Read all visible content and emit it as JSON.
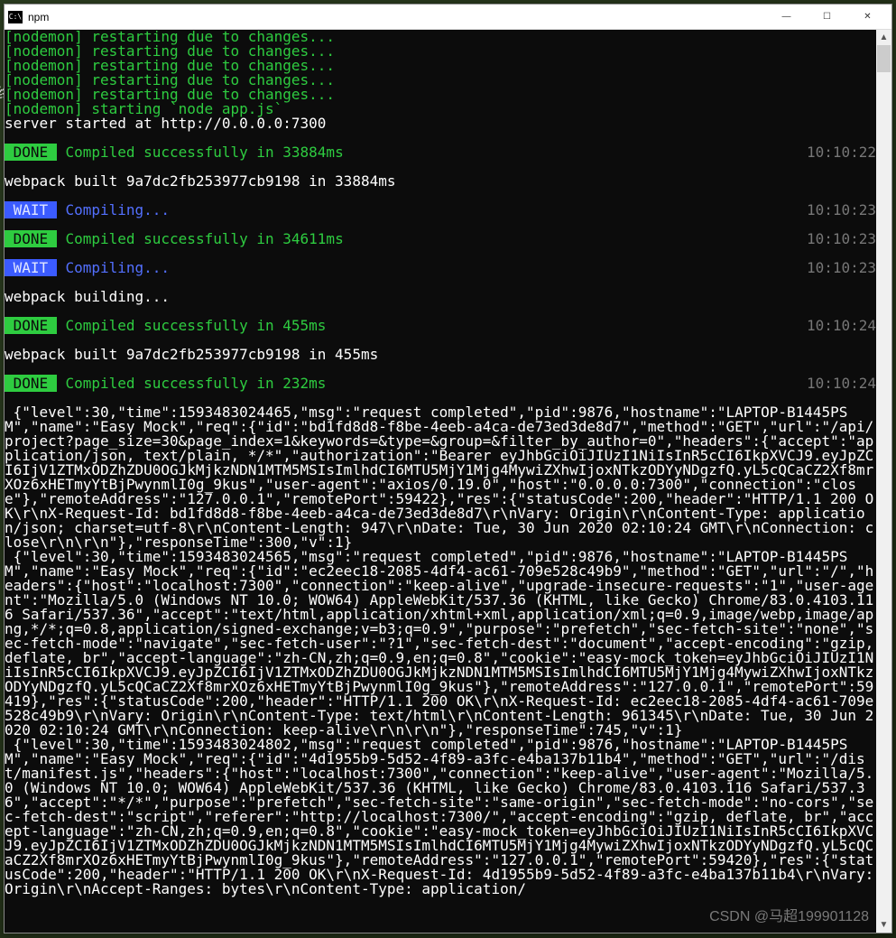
{
  "titlebar": {
    "title": "npm",
    "icon_label": "C:\\"
  },
  "controls": {
    "min": "—",
    "max": "☐",
    "close": "✕"
  },
  "nodemon_lines": [
    "[nodemon] restarting due to changes...",
    "[nodemon] restarting due to changes...",
    "[nodemon] restarting due to changes...",
    "[nodemon] restarting due to changes...",
    "[nodemon] restarting due to changes...",
    "[nodemon] starting `node app.js`"
  ],
  "server_line": "server started at http://0.0.0.0:7300",
  "events": [
    {
      "badge": "DONE",
      "badge_class": "badge-done",
      "msg": " Compiled successfully in 33884ms",
      "msg_class": "compiled",
      "time": "10:10:22",
      "after": "webpack built 9a7dc2fb253977cb9198 in 33884ms"
    },
    {
      "badge": "WAIT",
      "badge_class": "badge-wait",
      "msg": " Compiling...",
      "msg_class": "compiling",
      "time": "10:10:23",
      "after": ""
    },
    {
      "badge": "DONE",
      "badge_class": "badge-done",
      "msg": " Compiled successfully in 34611ms",
      "msg_class": "compiled",
      "time": "10:10:23",
      "after": ""
    },
    {
      "badge": "WAIT",
      "badge_class": "badge-wait",
      "msg": " Compiling...",
      "msg_class": "compiling",
      "time": "10:10:23",
      "after": "webpack building..."
    },
    {
      "badge": "DONE",
      "badge_class": "badge-done",
      "msg": " Compiled successfully in 455ms",
      "msg_class": "compiled",
      "time": "10:10:24",
      "after": "webpack built 9a7dc2fb253977cb9198 in 455ms"
    },
    {
      "badge": "DONE",
      "badge_class": "badge-done",
      "msg": " Compiled successfully in 232ms",
      "msg_class": "compiled",
      "time": "10:10:24",
      "after": ""
    }
  ],
  "json_dump": " {\"level\":30,\"time\":1593483024465,\"msg\":\"request completed\",\"pid\":9876,\"hostname\":\"LAPTOP-B1445PSM\",\"name\":\"Easy Mock\",\"req\":{\"id\":\"bd1fd8d8-f8be-4eeb-a4ca-de73ed3de8d7\",\"method\":\"GET\",\"url\":\"/api/project?page_size=30&page_index=1&keywords=&type=&group=&filter_by_author=0\",\"headers\":{\"accept\":\"application/json, text/plain, */*\",\"authorization\":\"Bearer eyJhbGciOiJIUzI1NiIsInR5cCI6IkpXVCJ9.eyJpZCI6IjV1ZTMxODZhZDU0OGJkMjkzNDN1MTM5MSIsImlhdCI6MTU5MjY1Mjg4MywiZXhwIjoxNTkzODYyNDgzfQ.yL5cQCaCZ2Xf8mrXOz6xHETmyYtBjPwynmlI0g_9kus\",\"user-agent\":\"axios/0.19.0\",\"host\":\"0.0.0.0:7300\",\"connection\":\"close\"},\"remoteAddress\":\"127.0.0.1\",\"remotePort\":59422},\"res\":{\"statusCode\":200,\"header\":\"HTTP/1.1 200 OK\\r\\nX-Request-Id: bd1fd8d8-f8be-4eeb-a4ca-de73ed3de8d7\\r\\nVary: Origin\\r\\nContent-Type: application/json; charset=utf-8\\r\\nContent-Length: 947\\r\\nDate: Tue, 30 Jun 2020 02:10:24 GMT\\r\\nConnection: close\\r\\n\\r\\n\"},\"responseTime\":300,\"v\":1}\n {\"level\":30,\"time\":1593483024565,\"msg\":\"request completed\",\"pid\":9876,\"hostname\":\"LAPTOP-B1445PSM\",\"name\":\"Easy Mock\",\"req\":{\"id\":\"ec2eec18-2085-4df4-ac61-709e528c49b9\",\"method\":\"GET\",\"url\":\"/\",\"headers\":{\"host\":\"localhost:7300\",\"connection\":\"keep-alive\",\"upgrade-insecure-requests\":\"1\",\"user-agent\":\"Mozilla/5.0 (Windows NT 10.0; WOW64) AppleWebKit/537.36 (KHTML, like Gecko) Chrome/83.0.4103.116 Safari/537.36\",\"accept\":\"text/html,application/xhtml+xml,application/xml;q=0.9,image/webp,image/apng,*/*;q=0.8,application/signed-exchange;v=b3;q=0.9\",\"purpose\":\"prefetch\",\"sec-fetch-site\":\"none\",\"sec-fetch-mode\":\"navigate\",\"sec-fetch-user\":\"?1\",\"sec-fetch-dest\":\"document\",\"accept-encoding\":\"gzip, deflate, br\",\"accept-language\":\"zh-CN,zh;q=0.9,en;q=0.8\",\"cookie\":\"easy-mock_token=eyJhbGciOiJIUzI1NiIsInR5cCI6IkpXVCJ9.eyJpZCI6IjV1ZTMxODZhZDU0OGJkMjkzNDN1MTM5MSIsImlhdCI6MTU5MjY1Mjg4MywiZXhwIjoxNTkzODYyNDgzfQ.yL5cQCaCZ2Xf8mrXOz6xHETmyYtBjPwynmlI0g_9kus\"},\"remoteAddress\":\"127.0.0.1\",\"remotePort\":59419},\"res\":{\"statusCode\":200,\"header\":\"HTTP/1.1 200 OK\\r\\nX-Request-Id: ec2eec18-2085-4df4-ac61-709e528c49b9\\r\\nVary: Origin\\r\\nContent-Type: text/html\\r\\nContent-Length: 961345\\r\\nDate: Tue, 30 Jun 2020 02:10:24 GMT\\r\\nConnection: keep-alive\\r\\n\\r\\n\"},\"responseTime\":745,\"v\":1}\n {\"level\":30,\"time\":1593483024802,\"msg\":\"request completed\",\"pid\":9876,\"hostname\":\"LAPTOP-B1445PSM\",\"name\":\"Easy Mock\",\"req\":{\"id\":\"4d1955b9-5d52-4f89-a3fc-e4ba137b11b4\",\"method\":\"GET\",\"url\":\"/dist/manifest.js\",\"headers\":{\"host\":\"localhost:7300\",\"connection\":\"keep-alive\",\"user-agent\":\"Mozilla/5.0 (Windows NT 10.0; WOW64) AppleWebKit/537.36 (KHTML, like Gecko) Chrome/83.0.4103.116 Safari/537.36\",\"accept\":\"*/*\",\"purpose\":\"prefetch\",\"sec-fetch-site\":\"same-origin\",\"sec-fetch-mode\":\"no-cors\",\"sec-fetch-dest\":\"script\",\"referer\":\"http://localhost:7300/\",\"accept-encoding\":\"gzip, deflate, br\",\"accept-language\":\"zh-CN,zh;q=0.9,en;q=0.8\",\"cookie\":\"easy-mock_token=eyJhbGciOiJIUzI1NiIsInR5cCI6IkpXVCJ9.eyJpZCI6IjV1ZTMxODZhZDU0OGJkMjkzNDN1MTM5MSIsImlhdCI6MTU5MjY1Mjg4MywiZXhwIjoxNTkzODYyNDgzfQ.yL5cQCaCZ2Xf8mrXOz6xHETmyYtBjPwynmlI0g_9kus\"},\"remoteAddress\":\"127.0.0.1\",\"remotePort\":59420},\"res\":{\"statusCode\":200,\"header\":\"HTTP/1.1 200 OK\\r\\nX-Request-Id: 4d1955b9-5d52-4f89-a3fc-e4ba137b11b4\\r\\nVary: Origin\\r\\nAccept-Ranges: bytes\\r\\nContent-Type: application/",
  "watermark": "CSDN @马超199901128"
}
